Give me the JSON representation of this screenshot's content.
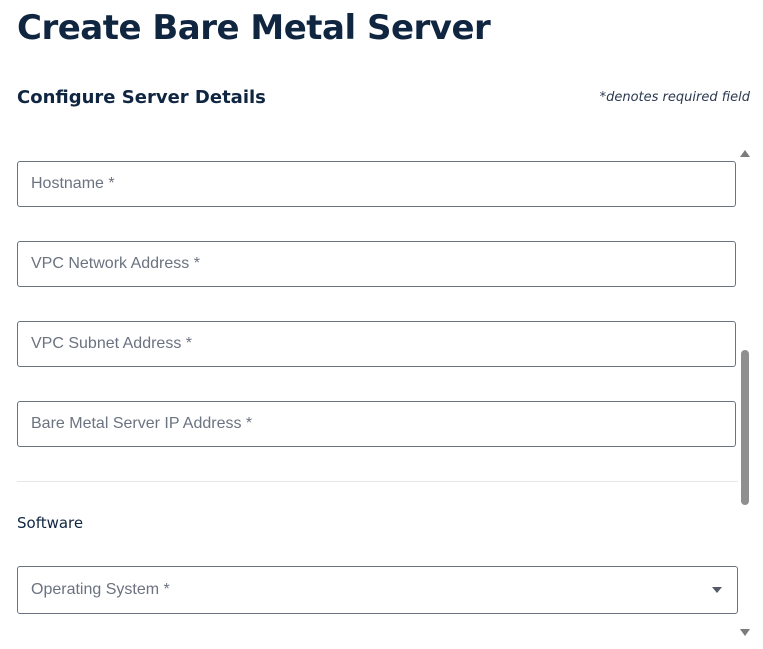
{
  "page": {
    "title": "Create Bare Metal Server"
  },
  "section": {
    "title": "Configure Server Details",
    "required_note": "*denotes required field"
  },
  "fields": {
    "hostname": {
      "placeholder": "Hostname *",
      "value": ""
    },
    "vpc_network_address": {
      "placeholder": "VPC Network Address *",
      "value": ""
    },
    "vpc_subnet_address": {
      "placeholder": "VPC Subnet Address *",
      "value": ""
    },
    "server_ip_address": {
      "placeholder": "Bare Metal Server IP Address *",
      "value": ""
    }
  },
  "software": {
    "label": "Software",
    "operating_system": {
      "placeholder": "Operating System *"
    }
  },
  "icons": {
    "dropdown": "chevron-down-icon",
    "scroll_up": "arrow-up-icon",
    "scroll_down": "arrow-down-icon"
  }
}
